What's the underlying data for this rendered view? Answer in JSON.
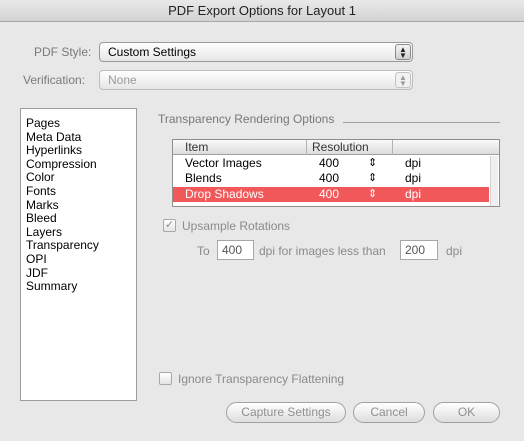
{
  "window": {
    "title": "PDF Export Options for Layout 1"
  },
  "pdf_style": {
    "label": "PDF Style:",
    "value": "Custom Settings",
    "icon": "stepper-arrows-icon"
  },
  "verification": {
    "label": "Verification:",
    "value": "None",
    "icon": "stepper-arrows-icon"
  },
  "sidebar": {
    "items": [
      {
        "label": "Pages"
      },
      {
        "label": "Meta Data"
      },
      {
        "label": "Hyperlinks"
      },
      {
        "label": "Compression"
      },
      {
        "label": "Color"
      },
      {
        "label": "Fonts"
      },
      {
        "label": "Marks"
      },
      {
        "label": "Bleed"
      },
      {
        "label": "Layers"
      },
      {
        "label": "Transparency"
      },
      {
        "label": "OPI"
      },
      {
        "label": "JDF"
      },
      {
        "label": "Summary"
      }
    ],
    "selected": "Transparency"
  },
  "transparency": {
    "group_title": "Transparency Rendering Options",
    "table": {
      "headers": {
        "item": "Item",
        "resolution": "Resolution"
      },
      "rows": [
        {
          "item": "Vector Images",
          "resolution": "400",
          "unit": "dpi",
          "selected": false
        },
        {
          "item": "Blends",
          "resolution": "400",
          "unit": "dpi",
          "selected": false
        },
        {
          "item": "Drop Shadows",
          "resolution": "400",
          "unit": "dpi",
          "selected": true
        }
      ],
      "selection_color": "#f0585a"
    },
    "upsample": {
      "label": "Upsample Rotations",
      "checked": true,
      "check_glyph": "✓",
      "to_label": "To",
      "to_value": "400",
      "mid_text": "dpi for images less than",
      "less_value": "200",
      "unit": "dpi"
    },
    "ignore_flattening": {
      "label": "Ignore Transparency Flattening",
      "checked": false
    }
  },
  "buttons": {
    "capture": "Capture Settings",
    "cancel": "Cancel",
    "ok": "OK"
  },
  "glyphs": {
    "stepper": "▲▼",
    "resolution_stepper": "⇕"
  }
}
